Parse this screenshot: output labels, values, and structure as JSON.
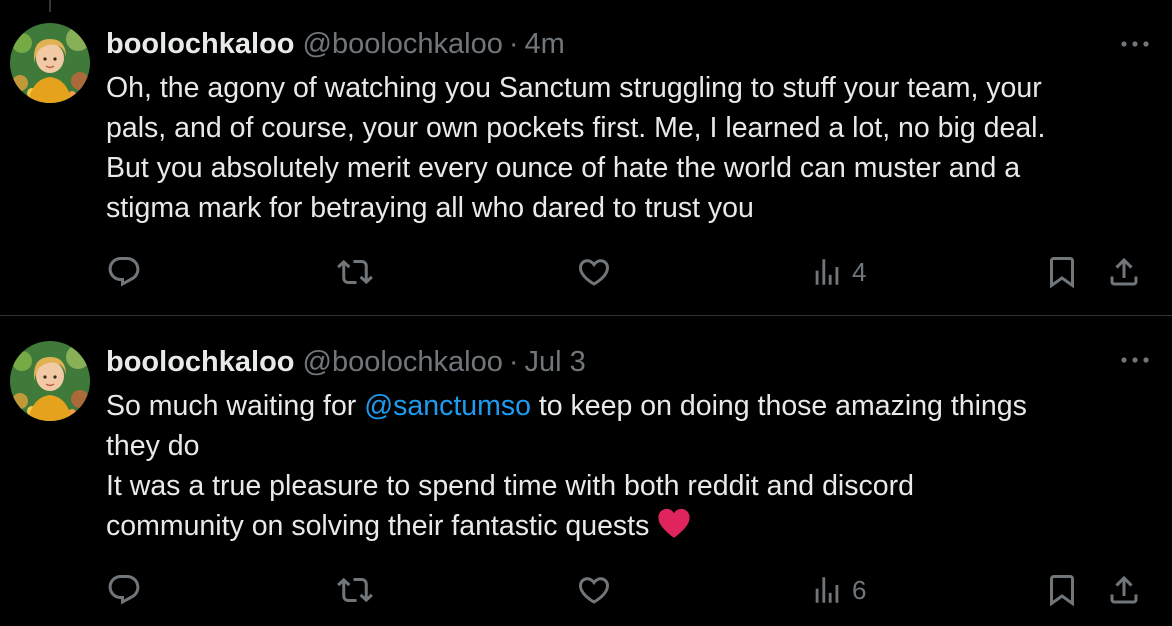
{
  "tweets": [
    {
      "display_name": "boolochkaloo",
      "handle": "@boolochkaloo",
      "separator": "·",
      "time": "4m",
      "lines": [
        "Oh, the agony of watching you Sanctum struggling to stuff your team, your",
        "pals, and of course, your own pockets first. Me, I learned a lot, no big deal.",
        "But you absolutely merit every ounce of hate the world can muster and a",
        "stigma mark for betraying all who dared to trust you"
      ],
      "views": "4",
      "icons": [
        "reply-icon",
        "retweet-icon",
        "like-icon",
        "views-icon",
        "bookmark-icon",
        "share-icon",
        "more-icon"
      ]
    },
    {
      "display_name": "boolochkaloo",
      "handle": "@boolochkaloo",
      "separator": "·",
      "time": "Jul 3",
      "line1_before": "So much waiting for ",
      "mention": "@sanctumso",
      "line1_after": " to keep on doing those amazing things",
      "lines_rest": [
        "they do",
        "It was a true pleasure to spend time with both reddit and discord"
      ],
      "last_line": "community on solving their fantastic quests ",
      "emoji": "❤️",
      "views": "6",
      "icons": [
        "reply-icon",
        "retweet-icon",
        "like-icon",
        "views-icon",
        "bookmark-icon",
        "share-icon",
        "more-icon"
      ]
    }
  ],
  "colors": {
    "background": "#000000",
    "text": "#e7e9ea",
    "secondary": "#71767b",
    "link": "#1d9bf0",
    "divider": "#2f3336",
    "heart": "#e0245e"
  }
}
